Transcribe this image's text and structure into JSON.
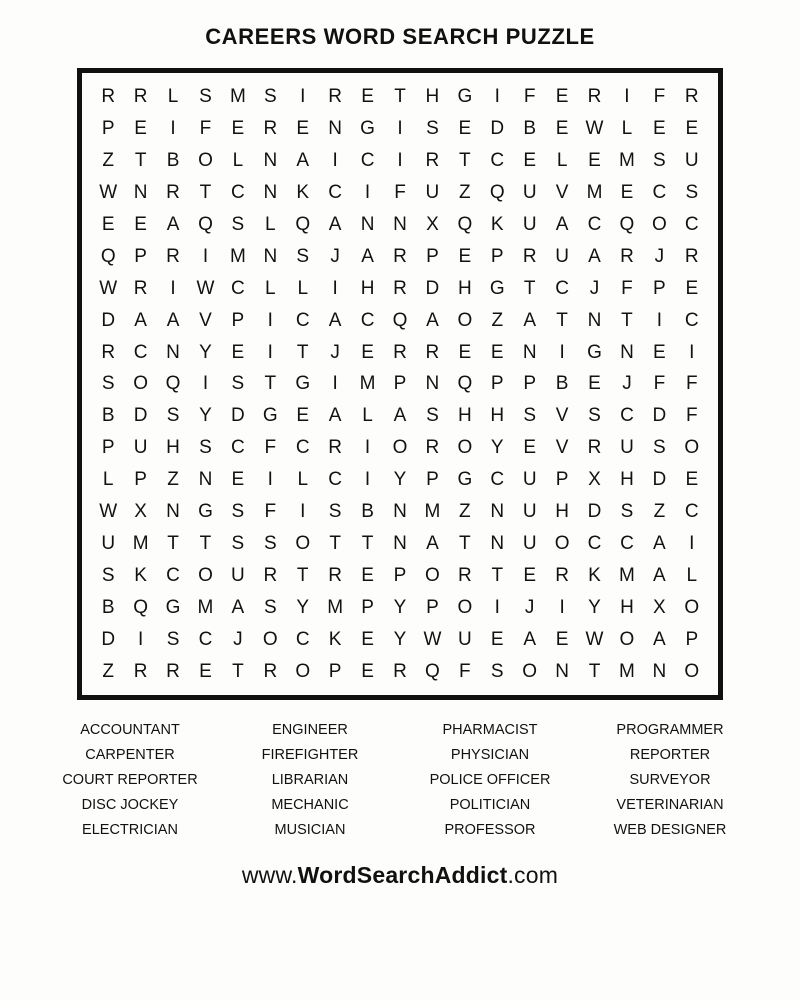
{
  "title": "CAREERS WORD SEARCH PUZZLE",
  "footer": {
    "prefix": "www.",
    "brand": "WordSearchAddict",
    "suffix": ".com",
    "full": "www.WordSearchAddict.com"
  },
  "grid": {
    "rows": 19,
    "cols": 19,
    "letters": [
      [
        "R",
        "R",
        "L",
        "S",
        "M",
        "S",
        "I",
        "R",
        "E",
        "T",
        "H",
        "G",
        "I",
        "F",
        "E",
        "R",
        "I",
        "F",
        "R"
      ],
      [
        "P",
        "E",
        "I",
        "F",
        "E",
        "R",
        "E",
        "N",
        "G",
        "I",
        "S",
        "E",
        "D",
        "B",
        "E",
        "W",
        "L",
        "E",
        "E"
      ],
      [
        "Z",
        "T",
        "B",
        "O",
        "L",
        "N",
        "A",
        "I",
        "C",
        "I",
        "R",
        "T",
        "C",
        "E",
        "L",
        "E",
        "M",
        "S",
        "U"
      ],
      [
        "W",
        "N",
        "R",
        "T",
        "C",
        "N",
        "K",
        "C",
        "I",
        "F",
        "U",
        "Z",
        "Q",
        "U",
        "V",
        "M",
        "E",
        "C",
        "S"
      ],
      [
        "E",
        "E",
        "A",
        "Q",
        "S",
        "L",
        "Q",
        "A",
        "N",
        "N",
        "X",
        "Q",
        "K",
        "U",
        "A",
        "C",
        "Q",
        "O",
        "C"
      ],
      [
        "Q",
        "P",
        "R",
        "I",
        "M",
        "N",
        "S",
        "J",
        "A",
        "R",
        "P",
        "E",
        "P",
        "R",
        "U",
        "A",
        "R",
        "J",
        "R"
      ],
      [
        "W",
        "R",
        "I",
        "W",
        "C",
        "L",
        "L",
        "I",
        "H",
        "R",
        "D",
        "H",
        "G",
        "T",
        "C",
        "J",
        "F",
        "P",
        "E"
      ],
      [
        "D",
        "A",
        "A",
        "V",
        "P",
        "I",
        "C",
        "A",
        "C",
        "Q",
        "A",
        "O",
        "Z",
        "A",
        "T",
        "N",
        "T",
        "I",
        "C"
      ],
      [
        "R",
        "C",
        "N",
        "Y",
        "E",
        "I",
        "T",
        "J",
        "E",
        "R",
        "R",
        "E",
        "E",
        "N",
        "I",
        "G",
        "N",
        "E",
        "I"
      ],
      [
        "S",
        "O",
        "Q",
        "I",
        "S",
        "T",
        "G",
        "I",
        "M",
        "P",
        "N",
        "Q",
        "P",
        "P",
        "B",
        "E",
        "J",
        "F",
        "F"
      ],
      [
        "B",
        "D",
        "S",
        "Y",
        "D",
        "G",
        "E",
        "A",
        "L",
        "A",
        "S",
        "H",
        "H",
        "S",
        "V",
        "S",
        "C",
        "D",
        "F"
      ],
      [
        "P",
        "U",
        "H",
        "S",
        "C",
        "F",
        "C",
        "R",
        "I",
        "O",
        "R",
        "O",
        "Y",
        "E",
        "V",
        "R",
        "U",
        "S",
        "O"
      ],
      [
        "L",
        "P",
        "Z",
        "N",
        "E",
        "I",
        "L",
        "C",
        "I",
        "Y",
        "P",
        "G",
        "C",
        "U",
        "P",
        "X",
        "H",
        "D",
        "E"
      ],
      [
        "W",
        "X",
        "N",
        "G",
        "S",
        "F",
        "I",
        "S",
        "B",
        "N",
        "M",
        "Z",
        "N",
        "U",
        "H",
        "D",
        "S",
        "Z",
        "C"
      ],
      [
        "U",
        "M",
        "T",
        "T",
        "S",
        "S",
        "O",
        "T",
        "T",
        "N",
        "A",
        "T",
        "N",
        "U",
        "O",
        "C",
        "C",
        "A",
        "I"
      ],
      [
        "S",
        "K",
        "C",
        "O",
        "U",
        "R",
        "T",
        "R",
        "E",
        "P",
        "O",
        "R",
        "T",
        "E",
        "R",
        "K",
        "M",
        "A",
        "L"
      ],
      [
        "B",
        "Q",
        "G",
        "M",
        "A",
        "S",
        "Y",
        "M",
        "P",
        "Y",
        "P",
        "O",
        "I",
        "J",
        "I",
        "Y",
        "H",
        "X",
        "O"
      ],
      [
        "D",
        "I",
        "S",
        "C",
        "J",
        "O",
        "C",
        "K",
        "E",
        "Y",
        "W",
        "U",
        "E",
        "A",
        "E",
        "W",
        "O",
        "A",
        "P"
      ],
      [
        "Z",
        "R",
        "R",
        "E",
        "T",
        "R",
        "O",
        "P",
        "E",
        "R",
        "Q",
        "F",
        "S",
        "O",
        "N",
        "T",
        "M",
        "N",
        "O"
      ]
    ]
  },
  "word_list": {
    "columns": [
      [
        "ACCOUNTANT",
        "CARPENTER",
        "COURT REPORTER",
        "DISC JOCKEY",
        "ELECTRICIAN"
      ],
      [
        "ENGINEER",
        "FIREFIGHTER",
        "LIBRARIAN",
        "MECHANIC",
        "MUSICIAN"
      ],
      [
        "PHARMACIST",
        "PHYSICIAN",
        "POLICE OFFICER",
        "POLITICIAN",
        "PROFESSOR"
      ],
      [
        "PROGRAMMER",
        "REPORTER",
        "SURVEYOR",
        "VETERINARIAN",
        "WEB DESIGNER"
      ]
    ]
  },
  "colors": {
    "page_background": "#fdfdfb",
    "text": "#111111",
    "grid_border": "#111111"
  }
}
